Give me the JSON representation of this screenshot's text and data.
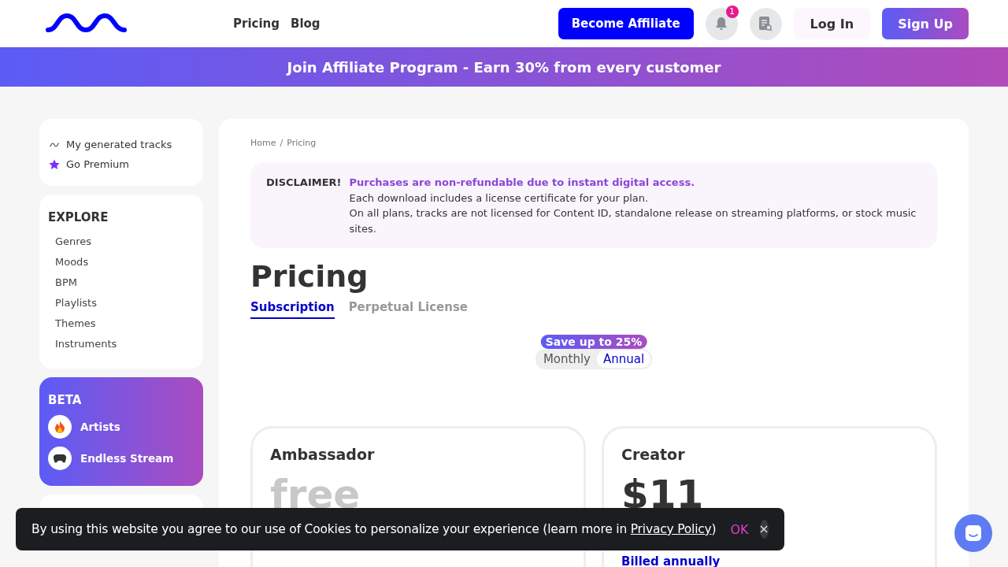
{
  "header": {
    "nav": [
      "Pricing",
      "Blog"
    ],
    "affiliate_button": "Become Affiliate",
    "notification_count": "1",
    "login": "Log In",
    "signup": "Sign Up"
  },
  "banner": "Join Affiliate Program - Earn 30% from every customer",
  "sidebar": {
    "top_items": [
      {
        "kind": "wave",
        "label": "My generated tracks"
      },
      {
        "kind": "star",
        "label": "Go Premium"
      }
    ],
    "explore": {
      "title": "EXPLORE",
      "items": [
        "Genres",
        "Moods",
        "BPM",
        "Playlists",
        "Themes",
        "Instruments"
      ]
    },
    "beta": {
      "title": "BETA",
      "items": [
        {
          "kind": "fire",
          "label": "Artists"
        },
        {
          "kind": "gamepad",
          "label": "Endless Stream"
        }
      ]
    }
  },
  "breadcrumb": {
    "separator": "/",
    "items": [
      "Home",
      "Pricing"
    ]
  },
  "disclaimer": {
    "label": "DISCLAIMER!",
    "headline": "Purchases are non-refundable due to instant digital access.",
    "lines": [
      "Each download includes a license certificate for your plan.",
      "On all plans, tracks are not licensed for Content ID, standalone release on streaming platforms, or stock music sites."
    ]
  },
  "title": "Pricing",
  "tabs": [
    {
      "label": "Subscription",
      "selected": true
    },
    {
      "label": "Perpetual License",
      "selected": false
    }
  ],
  "billing": {
    "badge": "Save up to 25%",
    "options": [
      {
        "label": "Monthly",
        "selected": false
      },
      {
        "label": "Annual",
        "selected": true
      }
    ]
  },
  "plans": [
    {
      "name": "Ambassador",
      "price": "free",
      "faded": true
    },
    {
      "name": "Creator",
      "price": "$11",
      "faded": false,
      "note": "Billed annually"
    }
  ],
  "cookie": {
    "text": "By using this website you agree to our use of Cookies to personalize your experience (learn more in ",
    "link": "Privacy Policy",
    "after": ")",
    "ok": "OK"
  }
}
